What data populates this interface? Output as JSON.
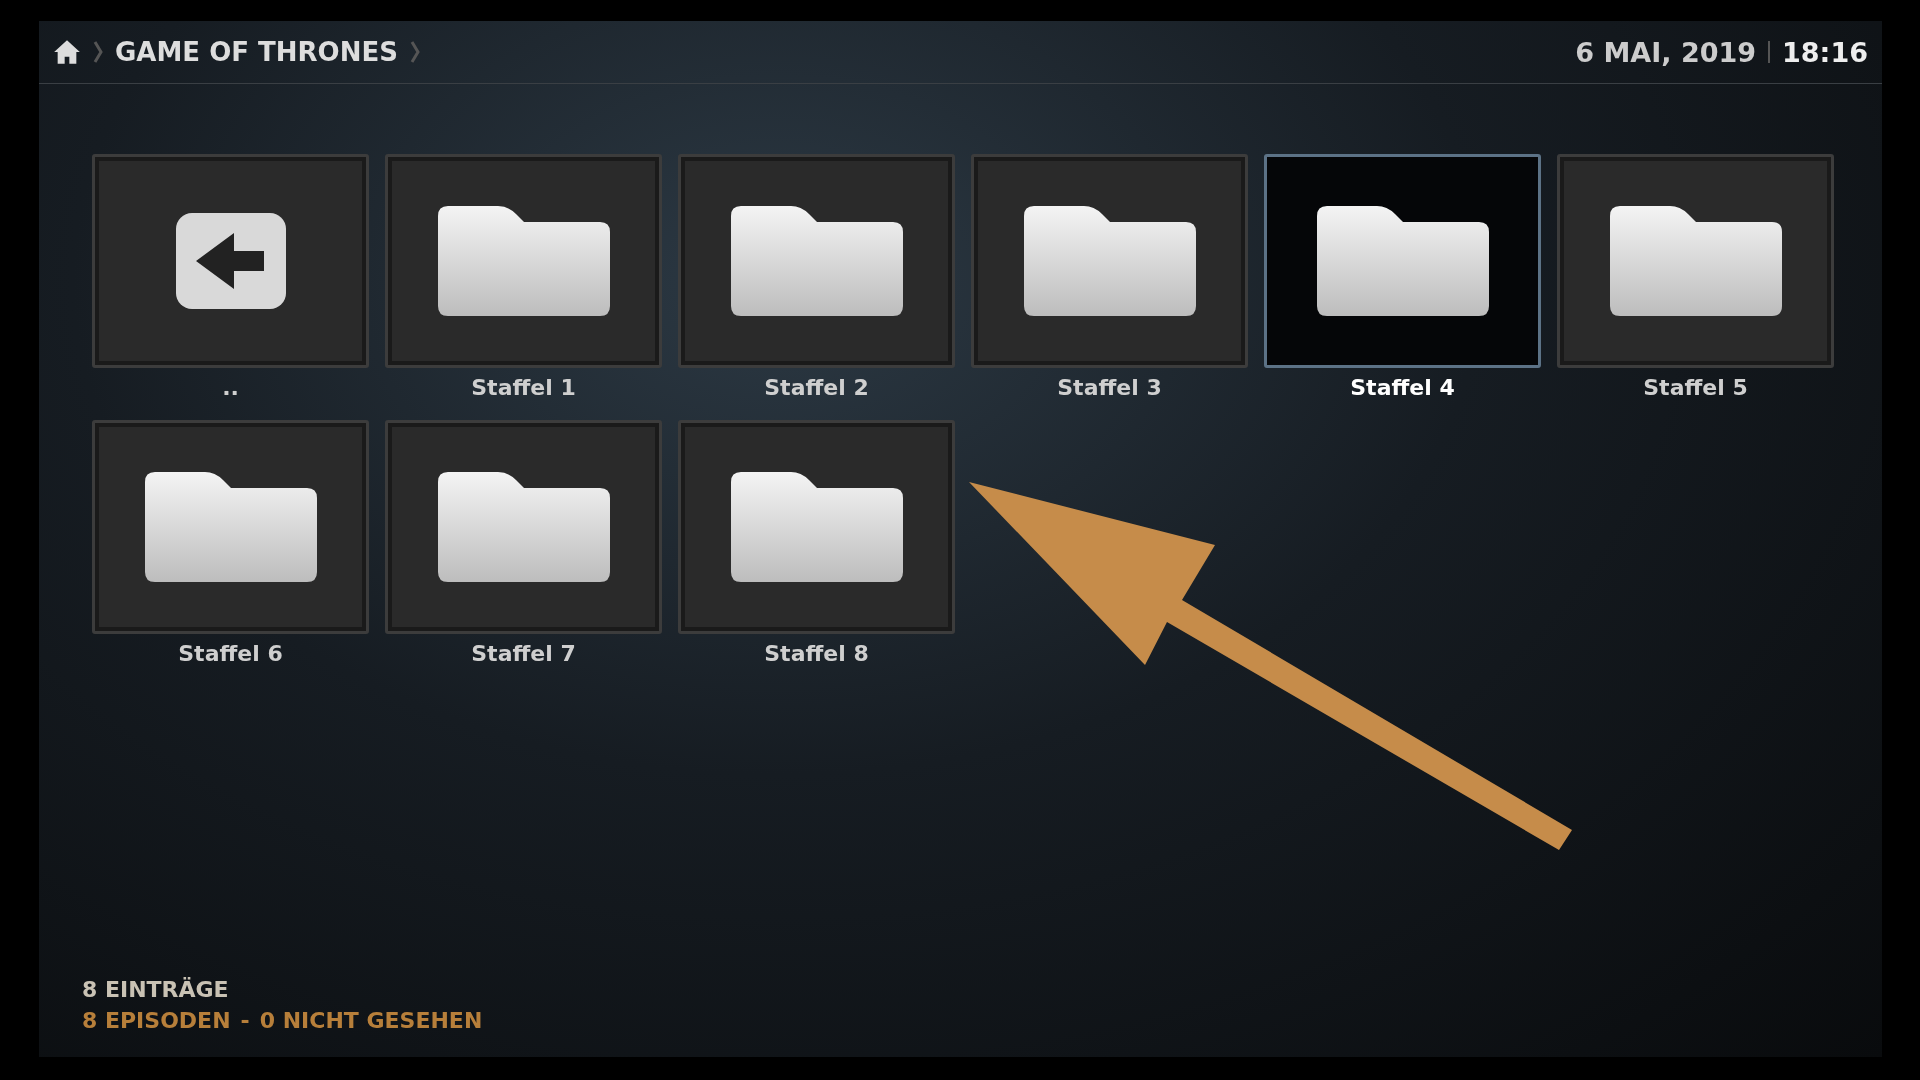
{
  "breadcrumb": {
    "items": [
      "GAME OF THRONES"
    ]
  },
  "datetime": {
    "date": "6 MAI, 2019",
    "time": "18:16"
  },
  "items": [
    {
      "kind": "back",
      "label": "..",
      "selected": false
    },
    {
      "kind": "folder",
      "label": "Staffel 1",
      "selected": false
    },
    {
      "kind": "folder",
      "label": "Staffel 2",
      "selected": false
    },
    {
      "kind": "folder",
      "label": "Staffel 3",
      "selected": false
    },
    {
      "kind": "folder",
      "label": "Staffel 4",
      "selected": true
    },
    {
      "kind": "folder",
      "label": "Staffel 5",
      "selected": false
    },
    {
      "kind": "folder",
      "label": "Staffel 6",
      "selected": false
    },
    {
      "kind": "folder",
      "label": "Staffel 7",
      "selected": false
    },
    {
      "kind": "folder",
      "label": "Staffel 8",
      "selected": false
    }
  ],
  "footer": {
    "count": "8 EINTRÄGE",
    "episodes": "8 EPISODEN",
    "separator": "-",
    "unwatched": "0 NICHT GESEHEN"
  }
}
